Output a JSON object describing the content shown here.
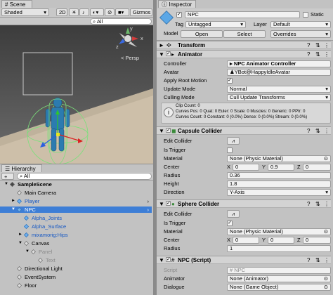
{
  "scene": {
    "tab": "Scene",
    "shading": "Shaded",
    "toggle_2d": "2D",
    "gizmos": "Gizmos",
    "search_placeholder": "All",
    "persp": "< Persp",
    "axis_y": "y",
    "axis_x": "x",
    "axis_z": "z"
  },
  "hierarchy": {
    "tab": "Hierarchy",
    "create": "+",
    "search_placeholder": "All",
    "rows": [
      {
        "label": "SampleScene",
        "indent": 0,
        "bold": true,
        "icon": "unity-scene-icon",
        "arrow": "▼"
      },
      {
        "label": "Main Camera",
        "indent": 1,
        "icon": "gameobject-icon",
        "arrow": ""
      },
      {
        "label": "Player",
        "indent": 1,
        "icon": "prefab-icon",
        "arrow": "►",
        "color": "blue",
        "more": true
      },
      {
        "label": "NPC",
        "indent": 1,
        "icon": "prefab-icon",
        "arrow": "▼",
        "selected": true,
        "more": true
      },
      {
        "label": "Alpha_Joints",
        "indent": 2,
        "icon": "prefab-icon",
        "arrow": "",
        "color": "blue"
      },
      {
        "label": "Alpha_Surface",
        "indent": 2,
        "icon": "prefab-icon",
        "arrow": "",
        "color": "blue"
      },
      {
        "label": "mixamorig:Hips",
        "indent": 2,
        "icon": "prefab-icon",
        "arrow": "►",
        "color": "blue"
      },
      {
        "label": "Canvas",
        "indent": 2,
        "icon": "gameobject-icon",
        "arrow": "▼"
      },
      {
        "label": "Panel",
        "indent": 3,
        "icon": "gameobject-icon",
        "arrow": "▼",
        "color": "faded"
      },
      {
        "label": "Text",
        "indent": 4,
        "icon": "gameobject-icon",
        "arrow": "",
        "color": "faded"
      },
      {
        "label": "Directional Light",
        "indent": 1,
        "icon": "gameobject-icon",
        "arrow": ""
      },
      {
        "label": "EventSystem",
        "indent": 1,
        "icon": "gameobject-icon",
        "arrow": ""
      },
      {
        "label": "Floor",
        "indent": 1,
        "icon": "gameobject-icon",
        "arrow": ""
      }
    ]
  },
  "inspector": {
    "tab": "Inspector",
    "object_name": "NPC",
    "static_label": "Static",
    "tag_label": "Tag",
    "tag_value": "Untagged",
    "layer_label": "Layer",
    "layer_value": "Default",
    "model_label": "Model",
    "open": "Open",
    "select": "Select",
    "overrides": "Overrides",
    "transform_title": "Transform",
    "animator": {
      "title": "Animator",
      "controller_label": "Controller",
      "controller_value": "NPC Animator Controller",
      "avatar_label": "Avatar",
      "avatar_value": "YBot@HappyIdleAvatar",
      "root_motion_label": "Apply Root Motion",
      "update_label": "Update Mode",
      "update_value": "Normal",
      "culling_label": "Culling Mode",
      "culling_value": "Cull Update Transforms",
      "info_lines": [
        "Clip Count: 0",
        "Curves Pos: 0 Quat: 0 Euler: 0 Scale: 0 Muscles: 0 Generic: 0 PPtr: 0",
        "Curves Count: 0 Constant: 0 (0.0%) Dense: 0 (0.0%) Stream: 0 (0.0%)"
      ]
    },
    "capsule": {
      "title": "Capsule Collider",
      "edit_label": "Edit Collider",
      "trigger_label": "Is Trigger",
      "material_label": "Material",
      "material_value": "None (Physic Material)",
      "center_label": "Center",
      "cx": "0",
      "cy": "0.9",
      "cz": "0",
      "radius_label": "Radius",
      "radius_value": "0.36",
      "height_label": "Height",
      "height_value": "1.8",
      "direction_label": "Direction",
      "direction_value": "Y-Axis"
    },
    "sphere": {
      "title": "Sphere Collider",
      "edit_label": "Edit Collider",
      "trigger_label": "Is Trigger",
      "material_label": "Material",
      "material_value": "None (Physic Material)",
      "center_label": "Center",
      "cx": "0",
      "cy": "0",
      "cz": "0",
      "radius_label": "Radius",
      "radius_value": "1"
    },
    "script": {
      "title": "NPC (Script)",
      "script_label": "Script",
      "script_value": "NPC",
      "animator_label": "Animator",
      "animator_value": "None (Animator)",
      "dialogue_label": "Dialogue",
      "dialogue_value": "None (Game Object)"
    },
    "xyz": {
      "x": "X",
      "y": "Y",
      "z": "Z"
    }
  }
}
